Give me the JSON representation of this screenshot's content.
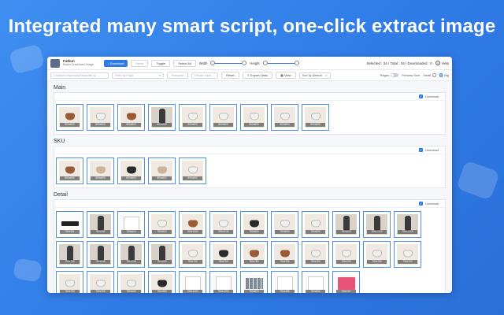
{
  "headline": "Integrated many smart script, one-click extract image",
  "app": {
    "name": "Fatkun",
    "subtitle": "Batch Download Image"
  },
  "toolbar": {
    "download_label": "↓ Download",
    "reset_sel_label": "Reset",
    "toggle_label": "Toggle",
    "select_all_label": "Select All",
    "width_label": "Width",
    "height_label": "Height",
    "width_value": 0,
    "height_value": 0,
    "stats_text": "Selected : 34 / Total : 34 / Downloaded : 0",
    "help_label": "Help"
  },
  "filters": {
    "keyword_placeholder": "Contains keywords(Separate by ...",
    "page_filter_placeholder": "Filter by Page",
    "rename_label": "Rename",
    "rename_input_placeholder": "Please input ...",
    "reset_label": "Reset",
    "export_label": "Export Links",
    "view_label": "View",
    "sort_label": "Sort by Default",
    "pages_label": "Pages",
    "preview_size_label": "Preview Size",
    "small_label": "Small",
    "big_label": "Big"
  },
  "sections": [
    {
      "title": "Main",
      "download_label": "Download",
      "items": [
        {
          "cap": "800x800",
          "kind": "brown"
        },
        {
          "cap": "800x800",
          "kind": "white"
        },
        {
          "cap": "800x800",
          "kind": "brown"
        },
        {
          "cap": "800x800",
          "kind": "model"
        },
        {
          "cap": "800x800",
          "kind": "white"
        },
        {
          "cap": "800x800",
          "kind": "white"
        },
        {
          "cap": "800x800",
          "kind": "white"
        },
        {
          "cap": "800x800",
          "kind": "white"
        },
        {
          "cap": "800x800",
          "kind": "white"
        }
      ]
    },
    {
      "title": "SKU",
      "download_label": "Download",
      "items": [
        {
          "cap": "800x800",
          "kind": "brown"
        },
        {
          "cap": "800x800",
          "kind": "tan"
        },
        {
          "cap": "800x800",
          "kind": "black"
        },
        {
          "cap": "800x800",
          "kind": "tan"
        },
        {
          "cap": "800x800",
          "kind": "white"
        }
      ]
    },
    {
      "title": "Detail",
      "download_label": "Download",
      "items": [
        {
          "cap": "750x331",
          "kind": "banner"
        },
        {
          "cap": "750x981",
          "kind": "model"
        },
        {
          "cap": "750x600",
          "kind": "doc"
        },
        {
          "cap": "750x600",
          "kind": "white"
        },
        {
          "cap": "750x1000",
          "kind": "brown"
        },
        {
          "cap": "750x1143",
          "kind": "white"
        },
        {
          "cap": "750x600",
          "kind": "black"
        },
        {
          "cap": "750x600",
          "kind": "white"
        },
        {
          "cap": "750x600",
          "kind": "white"
        },
        {
          "cap": "750x815",
          "kind": "model"
        },
        {
          "cap": "750x1012",
          "kind": "model"
        },
        {
          "cap": "750x1015",
          "kind": "model"
        },
        {
          "cap": "750x750",
          "kind": "model"
        },
        {
          "cap": "750x945",
          "kind": "model"
        },
        {
          "cap": "750x938",
          "kind": "model"
        },
        {
          "cap": "750x850",
          "kind": "model"
        },
        {
          "cap": "750x750",
          "kind": "white"
        },
        {
          "cap": "750x750",
          "kind": "black"
        },
        {
          "cap": "750x750",
          "kind": "brown"
        },
        {
          "cap": "750x750",
          "kind": "brown"
        },
        {
          "cap": "750x750",
          "kind": "white"
        },
        {
          "cap": "750x750",
          "kind": "white"
        },
        {
          "cap": "750x750",
          "kind": "white"
        },
        {
          "cap": "750x750",
          "kind": "white"
        },
        {
          "cap": "750x750",
          "kind": "white"
        },
        {
          "cap": "750x750",
          "kind": "white"
        },
        {
          "cap": "750x440",
          "kind": "white"
        },
        {
          "cap": "750x480",
          "kind": "black"
        },
        {
          "cap": "750x1400",
          "kind": "doc"
        },
        {
          "cap": "750x1200",
          "kind": "doc"
        },
        {
          "cap": "750x520",
          "kind": "grid"
        },
        {
          "cap": "750x480",
          "kind": "doc"
        },
        {
          "cap": "750x800",
          "kind": "doc"
        },
        {
          "cap": "750x707",
          "kind": "pink"
        }
      ]
    }
  ],
  "colors": {
    "accent": "#2f7be6",
    "background": "#3a88ee",
    "thumb_border": "#4d8fe8"
  }
}
